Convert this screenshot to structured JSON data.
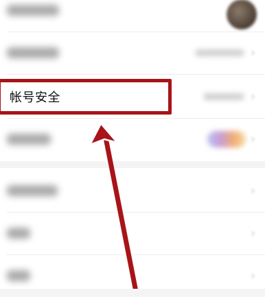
{
  "settings": {
    "highlighted_item_label": "帐号安全"
  },
  "colors": {
    "highlight": "#a81418",
    "arrow": "#a81418",
    "background": "#f4f4f4",
    "card": "#ffffff"
  },
  "icons": {
    "row_chevron": "chevron-right-icon",
    "avatar": "avatar",
    "annotation_arrow": "arrow-up-icon"
  }
}
